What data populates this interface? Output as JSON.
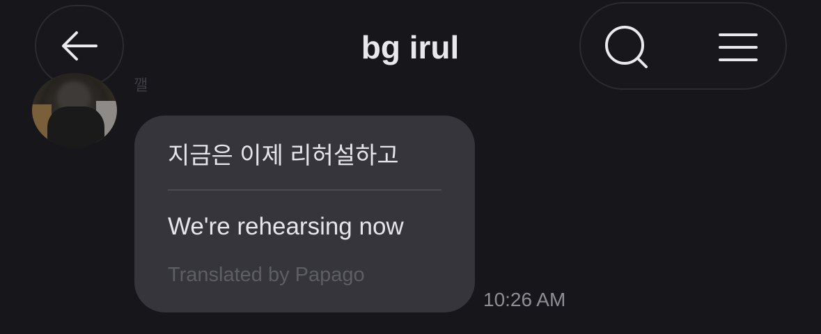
{
  "header": {
    "title": "bg irul",
    "back_icon": "arrow-left-icon",
    "search_icon": "search-icon",
    "menu_icon": "menu-icon"
  },
  "message": {
    "sender_name": "깰",
    "original_text": "지금은 이제 리허설하고",
    "translated_text": "We're rehearsing now",
    "translation_credit": "Translated by Papago",
    "timestamp": "10:26 AM"
  },
  "colors": {
    "background": "#16161b",
    "bubble": "#35353b",
    "text": "#e6e6ea",
    "muted": "#5e5e66",
    "timestamp": "#8e8e95"
  }
}
